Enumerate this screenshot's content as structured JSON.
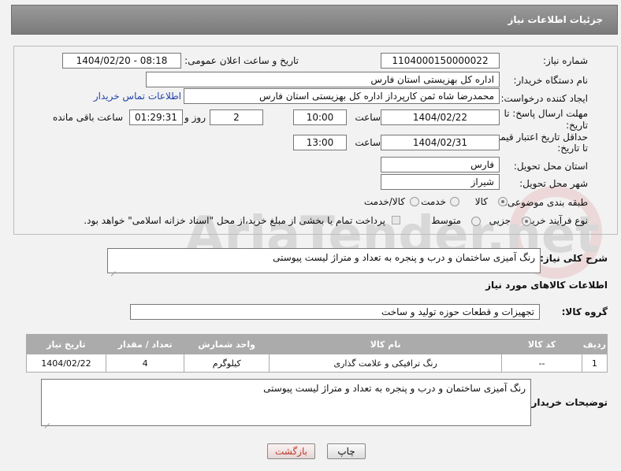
{
  "header": {
    "title": "جزئیات اطلاعات نیاز"
  },
  "form": {
    "need_number_label": "شماره نیاز:",
    "need_number": "1104000150000022",
    "announce_label": "تاریخ و ساعت اعلان عمومی:",
    "announce_value": "1404/02/20 - 08:18",
    "buyer_org_label": "نام دستگاه خریدار:",
    "buyer_org": "اداره کل بهزیستی استان فارس",
    "creator_label": "ایجاد کننده درخواست:",
    "creator": "محمدرضا شاه ثمن کارپرداز اداره کل بهزیستی استان فارس",
    "buyer_contact_link": "اطلاعات تماس خریدار",
    "deadline_label_1": "مهلت ارسال پاسخ: تا",
    "deadline_label_2": "تاریخ:",
    "deadline_date": "1404/02/22",
    "time_label": "ساعت",
    "deadline_time": "10:00",
    "days_value": "2",
    "days_label": "روز و",
    "remaining_time": "01:29:31",
    "remaining_label": "ساعت باقی مانده",
    "validity_label_1": "حداقل تاریخ اعتبار قیمت:",
    "validity_label_2": "تا تاریخ:",
    "validity_date": "1404/02/31",
    "validity_time": "13:00",
    "province_label": "استان محل تحویل:",
    "province": "فارس",
    "city_label": "شهر محل تحویل:",
    "city": "شیراز",
    "category_label": "طبقه بندی موضوعی:",
    "category_options": [
      "کالا",
      "خدمت",
      "کالا/خدمت"
    ],
    "category_selected": "کالا",
    "process_label": "نوع فرآیند خرید :",
    "process_options": [
      "جزیی",
      "متوسط"
    ],
    "process_selected": "جزیی",
    "payment_note": "پرداخت تمام یا بخشی از مبلغ خرید،از محل \"اسناد خزانه اسلامی\" خواهد بود."
  },
  "description": {
    "label": "شرح کلی نیاز:",
    "value": "رنگ آمیزی ساختمان و درب و پنجره به تعداد و متراژ لیست پیوستی"
  },
  "goods": {
    "section_title": "اطلاعات کالاهای مورد نیاز",
    "group_label": "گروه کالا:",
    "group_value": "تجهیزات و قطعات حوزه تولید و ساخت",
    "columns": [
      "ردیف",
      "کد کالا",
      "نام کالا",
      "واحد شمارش",
      "تعداد / مقدار",
      "تاریخ نیاز"
    ],
    "rows": [
      [
        "1",
        "--",
        "رنگ ترافیکی و علامت گذاری",
        "کیلوگرم",
        "4",
        "1404/02/22"
      ]
    ]
  },
  "buyer_notes": {
    "label": "توضیحات خریدار:",
    "value": "رنگ آمیزی ساختمان و درب و پنجره به تعداد و متراژ لیست پیوستی"
  },
  "buttons": {
    "print": "چاپ",
    "back": "بازگشت"
  },
  "watermark": {
    "text": "AriaTender.net"
  },
  "colors": {
    "header": "#8a8a8a",
    "link": "#2244aa",
    "table_header": "#ababab",
    "back_button_text": "#c0392b"
  }
}
